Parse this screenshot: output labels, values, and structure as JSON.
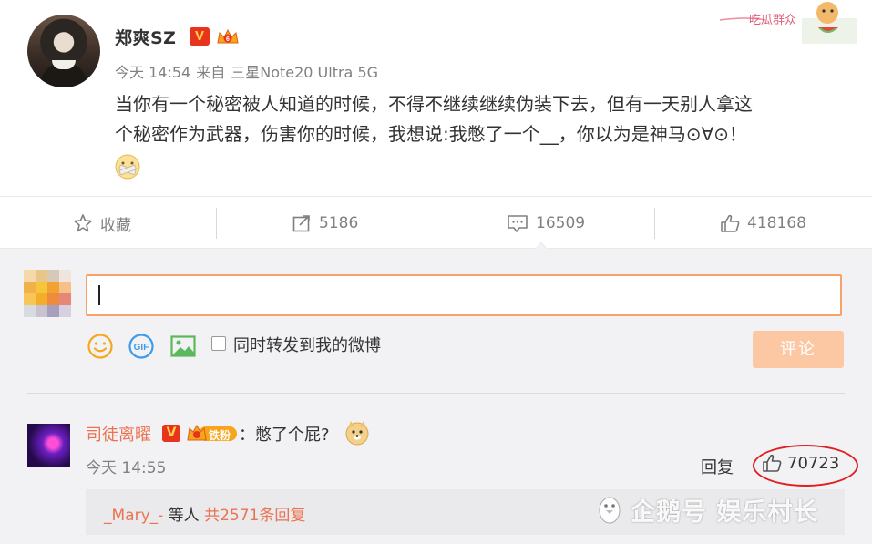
{
  "post": {
    "username": "郑爽SZ",
    "verified_badge": "V",
    "time": "今天 14:54",
    "source_prefix": "来自",
    "source_device": "三星Note20 Ultra 5G",
    "text_line1": "当你有一个秘密被人知道的时候，不得不继续继续伪装下去，但有一天别人拿这",
    "text_line2": "个秘密作为武器，伤害你的时候，我想说:我憋了一个__，你以为是神马⊙∀⊙！",
    "sticker_text": "吃瓜群众"
  },
  "actions": {
    "favorite_label": "收藏",
    "repost_count": "5186",
    "comment_count": "16509",
    "like_count": "418168"
  },
  "composer": {
    "repost_option": "同时转发到我的微博",
    "submit_label": "评论",
    "gif_label": "GIF"
  },
  "comment": {
    "username": "司徒离曜",
    "verified_badge": "V",
    "fan_badge": "铁粉",
    "text": "：憋了个屁?",
    "time": "今天 14:55",
    "reply_label": "回复",
    "like_count": "70723"
  },
  "replies_summary": {
    "user": "_Mary_-",
    "middle": " 等人 ",
    "count_text": "共2571条回复"
  },
  "watermark": {
    "text": "企鹅号 娱乐村长"
  },
  "colors": {
    "accent_orange": "#eb7350",
    "input_border": "#f5a36b",
    "submit_bg": "#fcc7a3",
    "highlight_red": "#e02020",
    "verified_red": "#e8331d"
  }
}
